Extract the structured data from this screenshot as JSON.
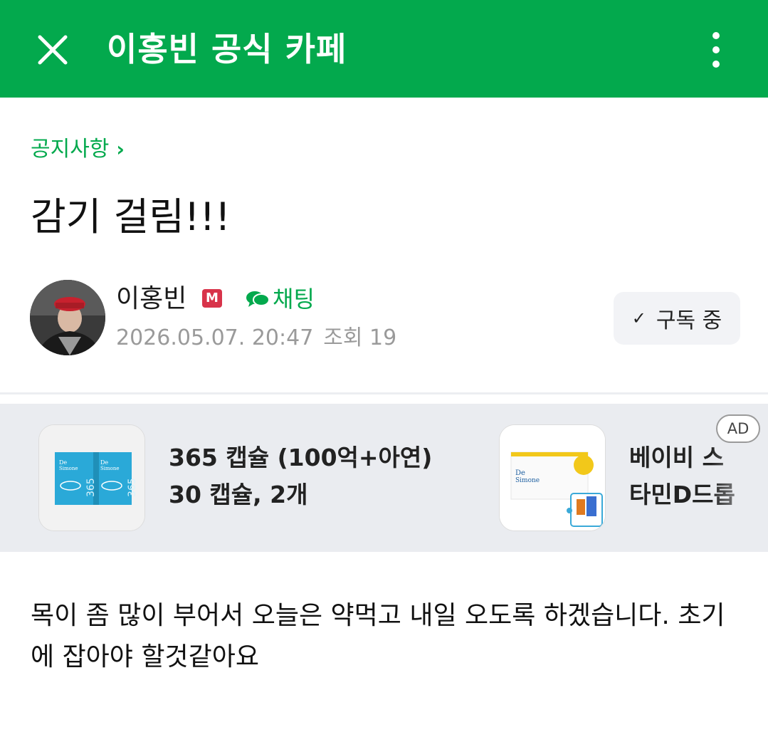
{
  "header": {
    "title": "이홍빈 공식 카페",
    "bg_color": "#03a94d",
    "close_icon": "close-icon",
    "more_icon": "more-vertical-icon"
  },
  "post": {
    "board": "공지사항",
    "title": "감기 걸림!!!",
    "author": "이홍빈",
    "author_badge": "M",
    "chat_label": "채팅",
    "date": "2026.05.07. 20:47",
    "views_label": "조회 19",
    "subscribe_label": "구독 중",
    "body": "목이 좀 많이 부어서 오늘은 약먹고 내일 오도록 하겠습니다. 초기에 잡아야 할것같아요"
  },
  "ads": {
    "badge": "AD",
    "items": [
      {
        "title": "365 캡슐 (100억+아연) 30 캡슐, 2개",
        "brand": "De Simone"
      },
      {
        "title": "베이비 스 타민D드롭",
        "brand": "De Simone"
      }
    ]
  }
}
